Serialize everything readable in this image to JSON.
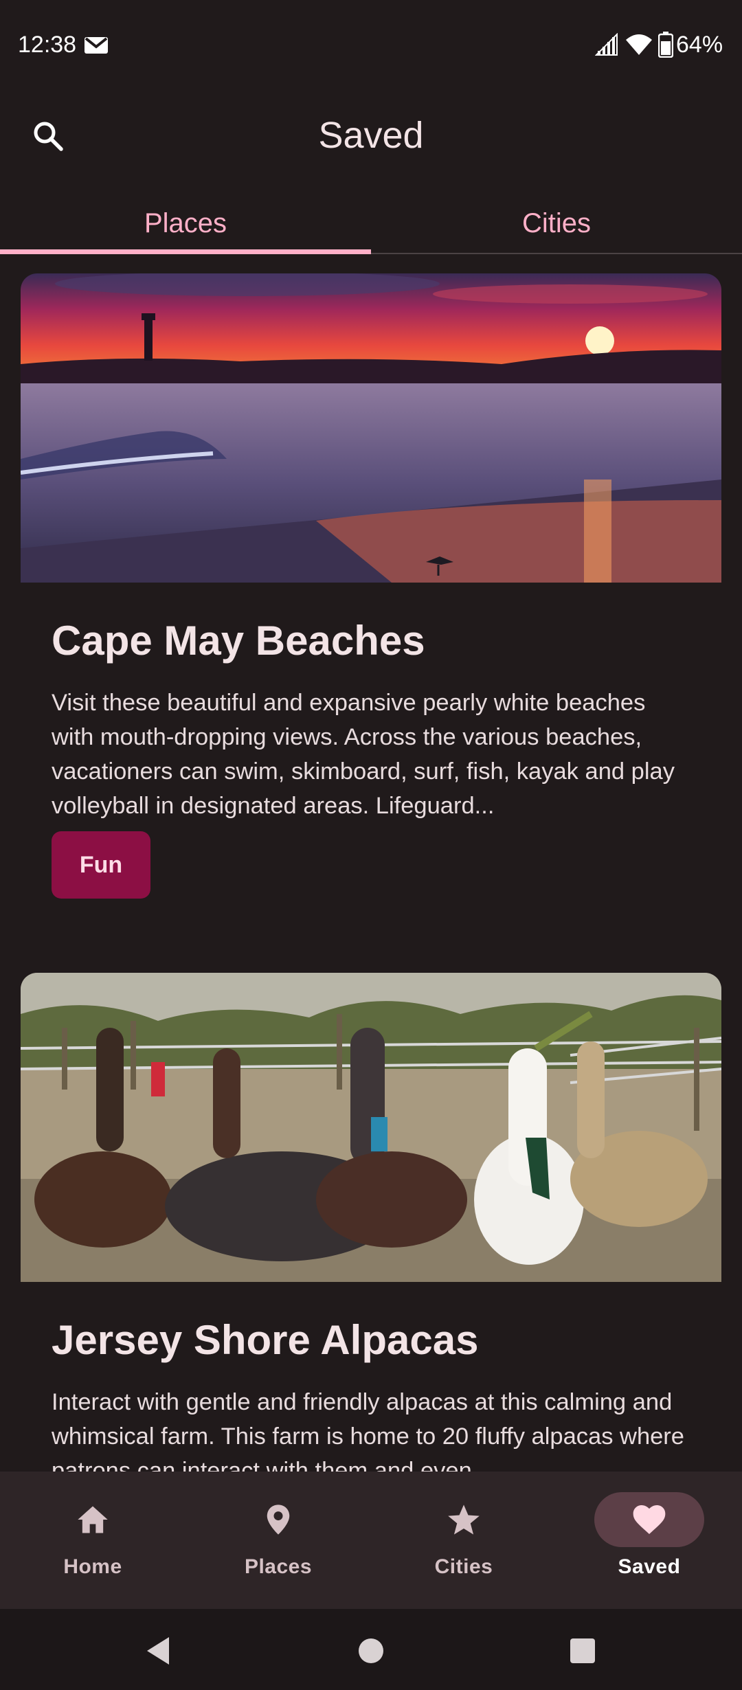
{
  "status_bar": {
    "time": "12:38",
    "battery": "64%",
    "icons": [
      "mail-icon",
      "signal-icon",
      "wifi-icon",
      "battery-icon"
    ]
  },
  "app_bar": {
    "title": "Saved",
    "search_icon": "search-icon"
  },
  "tabs": [
    {
      "label": "Places",
      "selected": true
    },
    {
      "label": "Cities",
      "selected": false
    }
  ],
  "cards": [
    {
      "title": "Cape May Beaches",
      "description": "Visit these beautiful and expansive pearly white beaches with mouth-dropping views. Across the various beaches, vacationers can swim, skimboard, surf, fish, kayak and play volleyball in designated areas. Lifeguard...",
      "chip": "Fun",
      "image": "beach-sunset-lighthouse"
    },
    {
      "title": "Jersey Shore Alpacas",
      "description": "Interact with gentle and friendly alpacas at this calming and whimsical farm. This farm is home to 20 fluffy alpacas where patrons can interact with them and even",
      "image": "alpacas-farm"
    }
  ],
  "bottom_nav": [
    {
      "label": "Home",
      "icon": "home-icon",
      "active": false
    },
    {
      "label": "Places",
      "icon": "place-pin-icon",
      "active": false
    },
    {
      "label": "Cities",
      "icon": "star-icon",
      "active": false
    },
    {
      "label": "Saved",
      "icon": "heart-icon",
      "active": true
    }
  ],
  "system_nav": [
    "back-icon",
    "home-circle-icon",
    "recents-icon"
  ],
  "colors": {
    "background": "#201a1b",
    "accent": "#ffb0c8",
    "chip": "#8c0f44",
    "nav_bar": "#2e2527",
    "nav_active_pill": "#5c3f47"
  }
}
